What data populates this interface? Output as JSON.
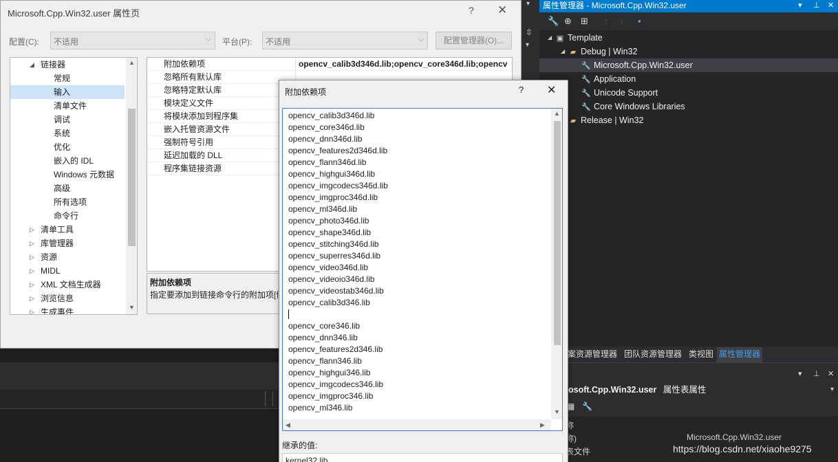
{
  "property_pages": {
    "title": "Microsoft.Cpp.Win32.user 属性页",
    "help_glyph": "?",
    "close_glyph": "✕",
    "config_label": "配置(C):",
    "config_value": "不适用",
    "platform_label": "平台(P):",
    "platform_value": "不适用",
    "config_manager_button": "配置管理器(O)...",
    "tree": [
      {
        "label": "链接器",
        "arrow": "◢",
        "indent": 0
      },
      {
        "label": "常规",
        "arrow": "",
        "indent": 1
      },
      {
        "label": "输入",
        "arrow": "",
        "indent": 1,
        "selected": true
      },
      {
        "label": "清单文件",
        "arrow": "",
        "indent": 1
      },
      {
        "label": "调试",
        "arrow": "",
        "indent": 1
      },
      {
        "label": "系统",
        "arrow": "",
        "indent": 1
      },
      {
        "label": "优化",
        "arrow": "",
        "indent": 1
      },
      {
        "label": "嵌入的 IDL",
        "arrow": "",
        "indent": 1
      },
      {
        "label": "Windows 元数据",
        "arrow": "",
        "indent": 1
      },
      {
        "label": "高级",
        "arrow": "",
        "indent": 1
      },
      {
        "label": "所有选项",
        "arrow": "",
        "indent": 1
      },
      {
        "label": "命令行",
        "arrow": "",
        "indent": 1
      },
      {
        "label": "清单工具",
        "arrow": "▷",
        "indent": 0
      },
      {
        "label": "库管理器",
        "arrow": "▷",
        "indent": 0
      },
      {
        "label": "资源",
        "arrow": "▷",
        "indent": 0
      },
      {
        "label": "MIDL",
        "arrow": "▷",
        "indent": 0
      },
      {
        "label": "XML 文档生成器",
        "arrow": "▷",
        "indent": 0
      },
      {
        "label": "浏览信息",
        "arrow": "▷",
        "indent": 0
      },
      {
        "label": "生成事件",
        "arrow": "▷",
        "indent": 0
      }
    ],
    "grid_rows": [
      {
        "key": "附加依赖项",
        "value": "opencv_calib3d346d.lib;opencv_core346d.lib;opencv"
      },
      {
        "key": "忽略所有默认库",
        "value": ""
      },
      {
        "key": "忽略特定默认库",
        "value": ""
      },
      {
        "key": "模块定义文件",
        "value": ""
      },
      {
        "key": "将模块添加到程序集",
        "value": ""
      },
      {
        "key": "嵌入托管资源文件",
        "value": ""
      },
      {
        "key": "强制符号引用",
        "value": ""
      },
      {
        "key": "延迟加载的 DLL",
        "value": ""
      },
      {
        "key": "程序集链接资源",
        "value": ""
      }
    ],
    "description_title": "附加依赖项",
    "description_body": "指定要添加到链接命令行的附加项[例"
  },
  "dependencies_dialog": {
    "title": "附加依赖项",
    "help_glyph": "?",
    "close_glyph": "✕",
    "lines": [
      "opencv_calib3d346d.lib",
      "opencv_core346d.lib",
      "opencv_dnn346d.lib",
      "opencv_features2d346d.lib",
      "opencv_flann346d.lib",
      "opencv_highgui346d.lib",
      "opencv_imgcodecs346d.lib",
      "opencv_imgproc346d.lib",
      "opencv_ml346d.lib",
      "opencv_photo346d.lib",
      "opencv_shape346d.lib",
      "opencv_stitching346d.lib",
      "opencv_superres346d.lib",
      "opencv_video346d.lib",
      "opencv_videoio346d.lib",
      "opencv_videostab346d.lib",
      "opencv_calib3d346.lib",
      "",
      "opencv_core346.lib",
      "opencv_dnn346.lib",
      "opencv_features2d346.lib",
      "opencv_flann346.lib",
      "opencv_highgui346.lib",
      "opencv_imgcodecs346.lib",
      "opencv_imgproc346.lib",
      "opencv_ml346.lib"
    ],
    "inherited_label": "继承的值:",
    "inherited_value": "kernel32.lib"
  },
  "property_manager": {
    "title": "属性管理器 - Microsoft.Cpp.Win32.user",
    "tree": [
      {
        "label": "Template",
        "icon": "project",
        "arrow": "◢",
        "level": 0
      },
      {
        "label": "Debug | Win32",
        "icon": "folder-open",
        "arrow": "◢",
        "level": 1
      },
      {
        "label": "Microsoft.Cpp.Win32.user",
        "icon": "wrench",
        "arrow": "",
        "level": 2,
        "selected": true
      },
      {
        "label": "Application",
        "icon": "wrench",
        "arrow": "",
        "level": 2
      },
      {
        "label": "Unicode Support",
        "icon": "wrench",
        "arrow": "",
        "level": 2
      },
      {
        "label": "Core Windows Libraries",
        "icon": "wrench",
        "arrow": "",
        "level": 2
      },
      {
        "label": "Release | Win32",
        "icon": "folder",
        "arrow": "▷",
        "level": 1
      }
    ],
    "tabs": [
      "案资源管理器",
      "团队资源管理器",
      "类视图",
      "属性管理器"
    ],
    "active_tab": 3,
    "props_object": "osoft.Cpp.Win32.user",
    "props_object_suffix": "属性表属性",
    "props_row_1": "称",
    "props_row_2_key": "称)",
    "props_row_2_value": "Microsoft.Cpp.Win32.user",
    "props_row_3": "表文件"
  },
  "watermark": "https://blog.csdn.net/xiaohe9275"
}
